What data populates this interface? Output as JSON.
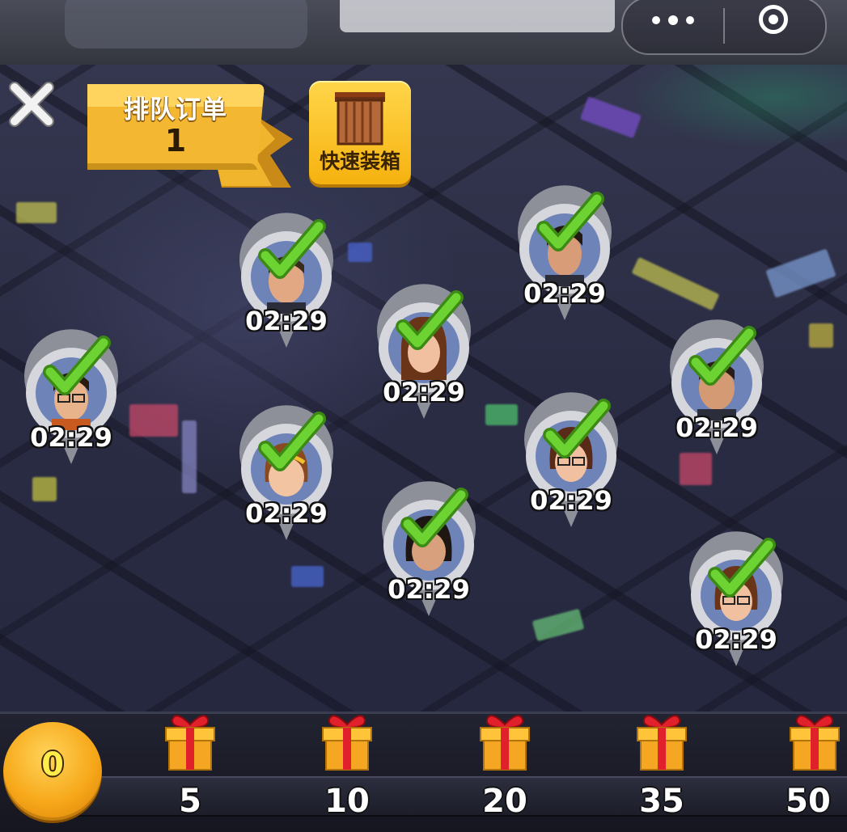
{
  "top_bar": {
    "menu_icon": "more-dots-icon",
    "close_icon": "target-close-icon"
  },
  "queue": {
    "title": "排队订单",
    "count": "1"
  },
  "quick_pack": {
    "label": "快速装箱",
    "icon": "crate-icon"
  },
  "customers": [
    {
      "timer": "02:29",
      "status": "ready",
      "avatar": "man-bald"
    },
    {
      "timer": "02:29",
      "status": "ready",
      "avatar": "man-dark-hair"
    },
    {
      "timer": "02:29",
      "status": "ready",
      "avatar": "woman-brown-hair"
    },
    {
      "timer": "02:29",
      "status": "ready",
      "avatar": "man-glasses"
    },
    {
      "timer": "02:29",
      "status": "ready",
      "avatar": "man-stubble"
    },
    {
      "timer": "02:29",
      "status": "ready",
      "avatar": "girl"
    },
    {
      "timer": "02:29",
      "status": "ready",
      "avatar": "woman-glasses"
    },
    {
      "timer": "02:29",
      "status": "ready",
      "avatar": "woman-dark-hair"
    },
    {
      "timer": "02:29",
      "status": "ready",
      "avatar": "woman-glasses-2"
    }
  ],
  "progress": {
    "current": "0",
    "milestones": [
      {
        "label": "5",
        "icon": "gift-icon"
      },
      {
        "label": "10",
        "icon": "gift-icon"
      },
      {
        "label": "20",
        "icon": "gift-icon"
      },
      {
        "label": "35",
        "icon": "gift-icon"
      },
      {
        "label": "50",
        "icon": "gift-icon"
      }
    ]
  },
  "colors": {
    "ribbon": "#f3b731",
    "button": "#f6b20f",
    "check": "#5ec12a",
    "coin": "#f7a81a"
  }
}
